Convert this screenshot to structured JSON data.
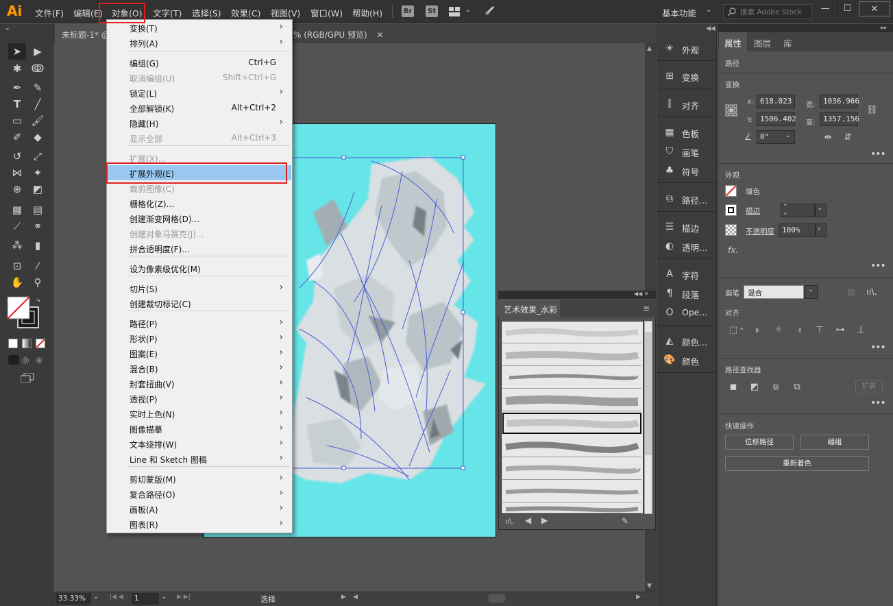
{
  "app": {
    "logo": "Ai"
  },
  "menubar": {
    "items": [
      "文件(F)",
      "编辑(E)",
      "对象(O)",
      "文字(T)",
      "选择(S)",
      "效果(C)",
      "视图(V)",
      "窗口(W)",
      "帮助(H)"
    ],
    "bridge": "Br",
    "stock": "St",
    "workspace": "基本功能",
    "search_placeholder": "搜索 Adobe Stock"
  },
  "tabs": {
    "doc1": "未标题-1* @",
    "doc2": "% (RGB/GPU 预览)"
  },
  "object_menu": [
    {
      "label": "变换(T)",
      "submenu": true
    },
    {
      "label": "排列(A)",
      "submenu": true
    },
    {
      "label": "编组(G)",
      "shortcut": "Ctrl+G"
    },
    {
      "label": "取消编组(U)",
      "shortcut": "Shift+Ctrl+G",
      "disabled": true
    },
    {
      "label": "锁定(L)",
      "submenu": true
    },
    {
      "label": "全部解锁(K)",
      "shortcut": "Alt+Ctrl+2"
    },
    {
      "label": "隐藏(H)",
      "submenu": true
    },
    {
      "label": "显示全部",
      "shortcut": "Alt+Ctrl+3",
      "disabled": true
    },
    {
      "label": "扩展(X)...",
      "disabled": true
    },
    {
      "label": "扩展外观(E)",
      "highlighted": true
    },
    {
      "label": "裁剪图像(C)",
      "disabled": true
    },
    {
      "label": "栅格化(Z)..."
    },
    {
      "label": "创建渐变网格(D)..."
    },
    {
      "label": "创建对象马赛克(J)...",
      "disabled": true
    },
    {
      "label": "拼合透明度(F)..."
    },
    {
      "label": "设为像素级优化(M)"
    },
    {
      "label": "切片(S)",
      "submenu": true
    },
    {
      "label": "创建裁切标记(C)"
    },
    {
      "label": "路径(P)",
      "submenu": true
    },
    {
      "label": "形状(P)",
      "submenu": true
    },
    {
      "label": "图案(E)",
      "submenu": true
    },
    {
      "label": "混合(B)",
      "submenu": true
    },
    {
      "label": "封套扭曲(V)",
      "submenu": true
    },
    {
      "label": "透视(P)",
      "submenu": true
    },
    {
      "label": "实时上色(N)",
      "submenu": true
    },
    {
      "label": "图像描摹",
      "submenu": true
    },
    {
      "label": "文本绕排(W)",
      "submenu": true
    },
    {
      "label": "Line 和 Sketch 图稿",
      "submenu": true
    },
    {
      "label": "剪切蒙版(M)",
      "submenu": true
    },
    {
      "label": "复合路径(O)",
      "submenu": true
    },
    {
      "label": "画板(A)",
      "submenu": true
    },
    {
      "label": "图表(R)",
      "submenu": true
    }
  ],
  "brush_panel": {
    "title": "艺术效果_水彩"
  },
  "mid_panel": [
    {
      "label": "外观",
      "icon": "sun-icon"
    },
    {
      "label": "变换",
      "icon": "transform-icon"
    },
    {
      "label": "对齐",
      "icon": "align-icon"
    },
    {
      "label": "色板",
      "icon": "swatches-icon"
    },
    {
      "label": "画笔",
      "icon": "brush-icon"
    },
    {
      "label": "符号",
      "icon": "club-icon"
    },
    {
      "label": "路径...",
      "icon": "pathfinder-icon"
    },
    {
      "label": "描边",
      "icon": "stroke-icon"
    },
    {
      "label": "透明...",
      "icon": "transparency-icon"
    },
    {
      "label": "字符",
      "icon": "character-icon"
    },
    {
      "label": "段落",
      "icon": "paragraph-icon"
    },
    {
      "label": "Ope...",
      "icon": "opentype-icon"
    },
    {
      "label": "颜色...",
      "icon": "color-guide-icon"
    },
    {
      "label": "颜色",
      "icon": "palette-icon"
    }
  ],
  "props": {
    "tabs": [
      "属性",
      "图层",
      "库"
    ],
    "path_label": "路径",
    "transform": {
      "title": "变换",
      "x_label": "X:",
      "x": "618.023",
      "y_label": "Y:",
      "y": "1506.402",
      "w_label": "宽:",
      "w": "1036.966",
      "h_label": "高:",
      "h": "1357.156",
      "angle": "0°"
    },
    "appearance": {
      "title": "外观",
      "fill": "填色",
      "stroke": "描边",
      "opacity_label": "不透明度",
      "opacity": "100%",
      "fx": "fx."
    },
    "brush": {
      "label": "画笔",
      "value": "混合"
    },
    "align_title": "对齐",
    "pathfinder": {
      "title": "路径查找器",
      "expand": "扩展"
    },
    "quick_actions": {
      "title": "快速操作",
      "offset": "位移路径",
      "group": "编组",
      "recolor": "重新着色"
    }
  },
  "status": {
    "zoom": "33.33%",
    "page": "1",
    "tool": "选择"
  }
}
